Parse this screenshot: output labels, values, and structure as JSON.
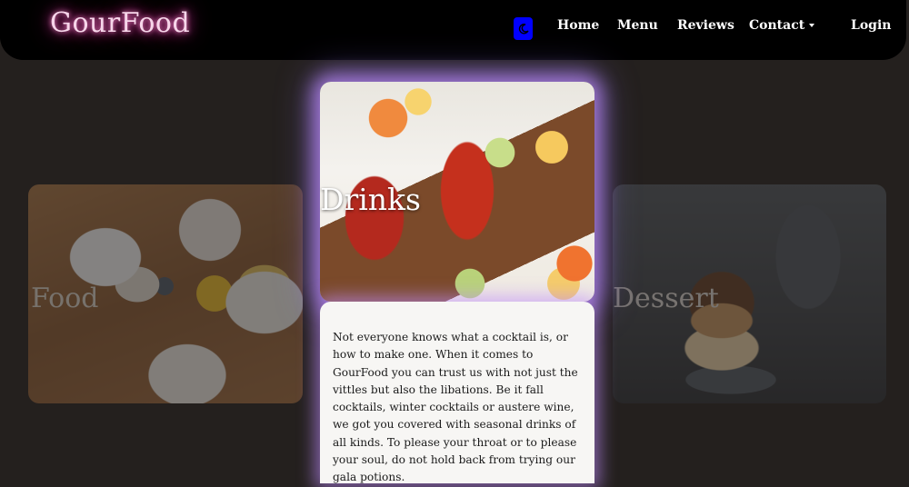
{
  "navbar": {
    "brand": "GourFood",
    "theme_toggle_icon": "moon-icon",
    "links": {
      "home": "Home",
      "menu": "Menu",
      "reviews": "Reviews",
      "contact": "Contact",
      "login": "Login"
    }
  },
  "cards": {
    "food": {
      "title": "Food"
    },
    "drinks": {
      "title": "Drinks",
      "description": "Not everyone knows what a cocktail is, or how to make one. When it comes to GourFood you can trust us with not just the vittles but also the libations. Be it fall cocktails, winter cocktails or austere wine, we got you covered with seasonal drinks of all kinds. To please your throat or to please your soul, do not hold back from trying our gala potions."
    },
    "dessert": {
      "title": "Dessert"
    }
  },
  "colors": {
    "background": "#24201e",
    "navbar": "#000000",
    "brand_glow": "#e33ea8",
    "toggle": "#0000ff",
    "active_glow": "#bf8cff"
  }
}
